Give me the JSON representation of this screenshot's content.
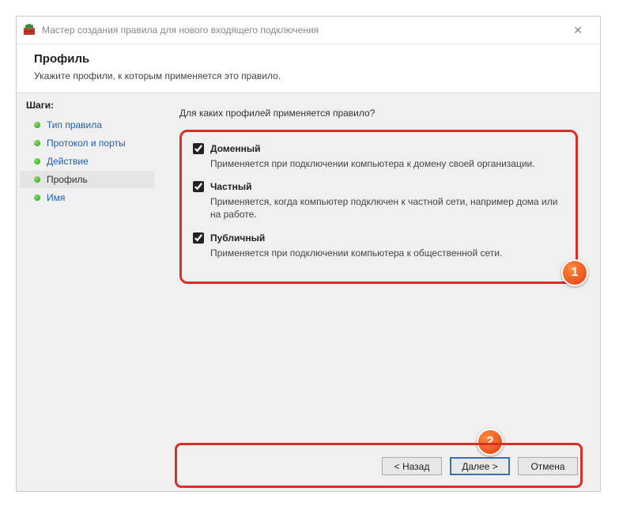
{
  "window": {
    "title": "Мастер создания правила для нового входящего подключения",
    "close_label": "✕"
  },
  "header": {
    "title": "Профиль",
    "subtitle": "Укажите профили, к которым применяется это правило."
  },
  "sidebar": {
    "header": "Шаги:",
    "items": [
      {
        "label": "Тип правила"
      },
      {
        "label": "Протокол и порты"
      },
      {
        "label": "Действие"
      },
      {
        "label": "Профиль"
      },
      {
        "label": "Имя"
      }
    ]
  },
  "main": {
    "question": "Для каких профилей применяется правило?"
  },
  "options": [
    {
      "name": "Доменный",
      "desc": "Применяется при подключении компьютера к домену своей организации."
    },
    {
      "name": "Частный",
      "desc": "Применяется, когда компьютер подключен к частной сети, например дома или на работе."
    },
    {
      "name": "Публичный",
      "desc": "Применяется при подключении компьютера к общественной сети."
    }
  ],
  "buttons": {
    "back": "< Назад",
    "next": "Далее >",
    "cancel": "Отмена"
  },
  "callouts": {
    "one": "1",
    "two": "2"
  }
}
